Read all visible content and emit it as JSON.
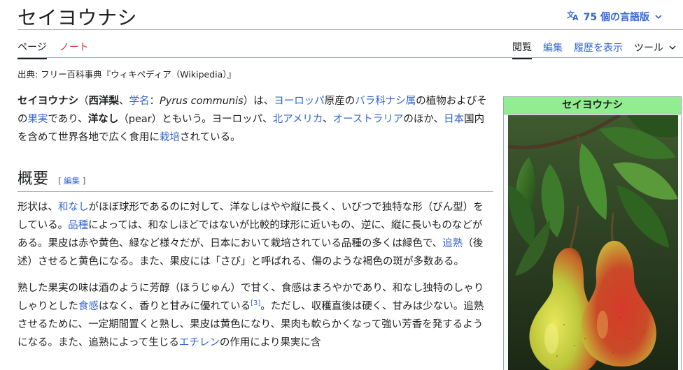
{
  "page": {
    "title": "セイヨウナシ",
    "language_button": "75 個の言語版",
    "tabs_left": [
      "ページ",
      "ノート"
    ],
    "tabs_right": [
      "閲覧",
      "編集",
      "履歴を表示",
      "ツール"
    ],
    "source_line": "出典: フリー百科事典『ウィキペディア（Wikipedia）』"
  },
  "intro": {
    "s1": "セイヨウナシ",
    "s2": "（",
    "s3": "西洋梨",
    "s4": "、",
    "s5": "学名",
    "s6": "：",
    "s7": "Pyrus communis",
    "s8": "）は、",
    "s9": "ヨーロッパ",
    "s10": "原産の",
    "s11": "バラ科ナシ属",
    "s12": "の植物およびその",
    "s13": "果実",
    "s14": "であり、",
    "s15": "洋なし",
    "s16": "（pear）ともいう。ヨーロッパ、",
    "s17": "北アメリカ",
    "s18": "、",
    "s19": "オーストラリア",
    "s20": "のほか、",
    "s21": "日本",
    "s22": "国内を含めて世界各地で広く食用に",
    "s23": "栽培",
    "s24": "されている。"
  },
  "section": {
    "heading": "概要",
    "edit_link": "編集",
    "edit_open": "[ ",
    "edit_close": " ]",
    "p1_a": "形状は、",
    "p1_b": "和なし",
    "p1_c": "がほぼ球形であるのに対して、洋なしはやや縦に長く、いびつで独特な形（びん型）をしている。",
    "p1_d": "品種",
    "p1_e": "によっては、和なしほどではないが比較的球形に近いもの、逆に、縦に長いものなどがある。果皮は赤や黄色、緑など様々だが、日本において栽培されている品種の多くは緑色で、",
    "p1_f": "追熟",
    "p1_g": "（後述）させると黄色になる。また、果皮には「さび」と呼ばれる、傷のような褐色の斑が多数ある。",
    "p2_a": "熟した果実の味は酒のように芳醇（ほうじゅん）で甘く、食感はまろやかであり、和なし独特のしゃりしゃりとした",
    "p2_b": "食感",
    "p2_c": "はなく、香りと甘みに優れている",
    "p2_ref": "[3]",
    "p2_d": "。ただし、収穫直後は硬く、甘みは少ない。追熟させるために、一定期間置くと熟し、果皮は黄色になり、果肉も軟らかくなって強い芳香を発するようになる。また、追熟によって生じる",
    "p2_e": "エチレン",
    "p2_f": "の作用により果実に含"
  },
  "infobox": {
    "title": "セイヨウナシ",
    "header_color": "#90ee90"
  },
  "colors": {
    "link": "#3366cc",
    "talk_red": "#d73333",
    "rule": "#a2a9b1"
  }
}
